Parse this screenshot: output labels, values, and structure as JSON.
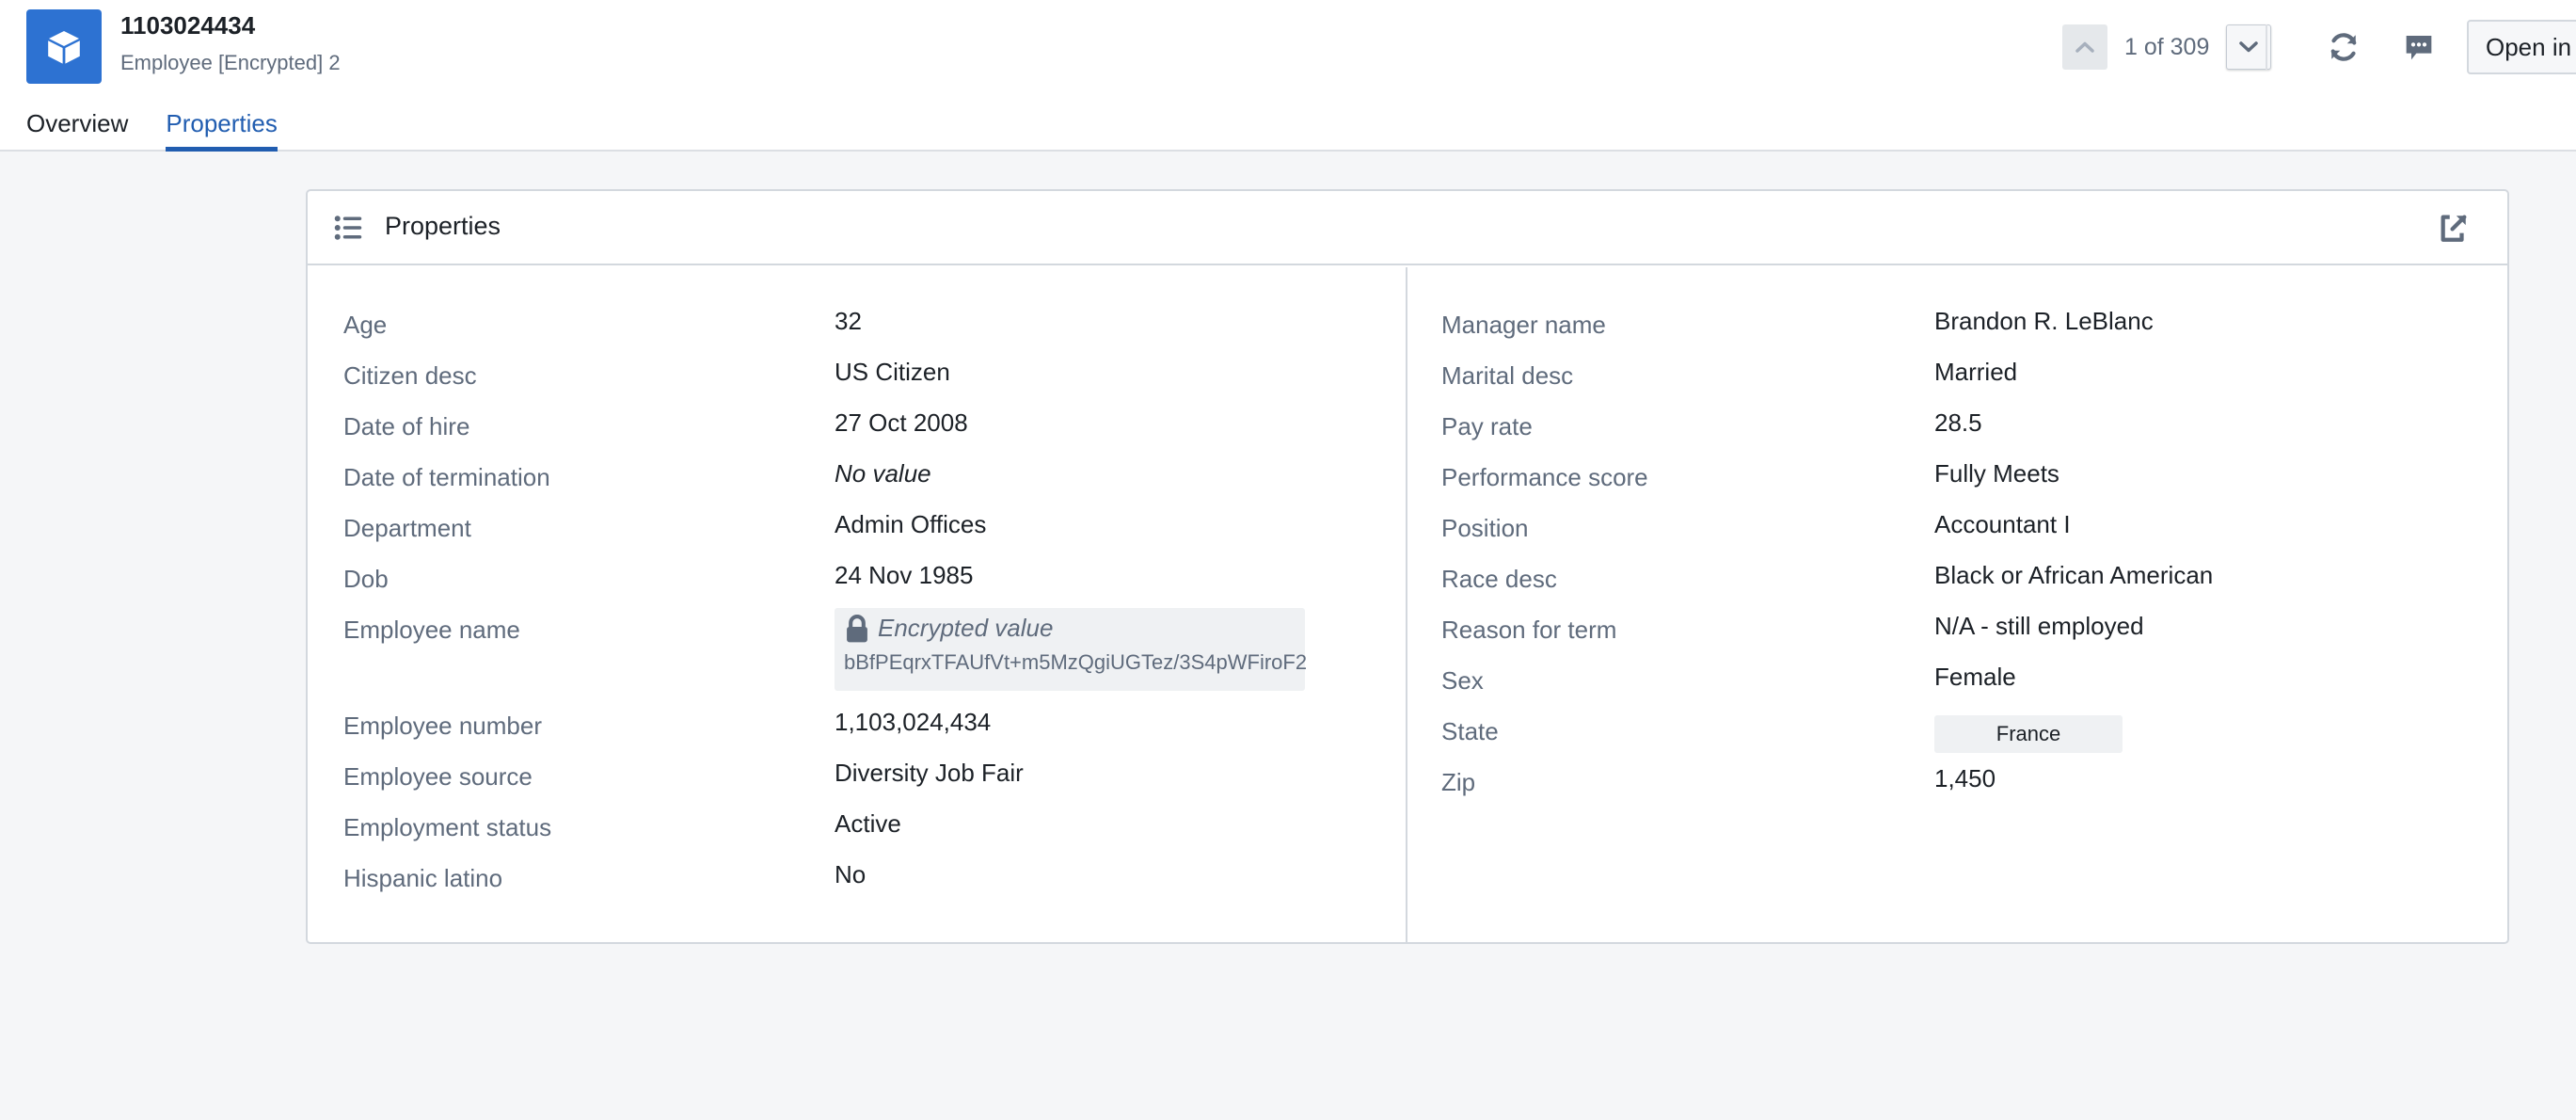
{
  "header": {
    "title": "1103024434",
    "subtitle": "Employee [Encrypted] 2",
    "logo_icon": "cube-icon",
    "accent_color": "#2d72d2",
    "tabs": [
      {
        "label": "Overview",
        "active": false
      },
      {
        "label": "Properties",
        "active": true
      }
    ],
    "navigation": {
      "counter": "1 of 309",
      "prev_icon": "chevron-up-icon",
      "next_icon": "chevron-down-icon"
    },
    "actions": {
      "refresh_icon": "refresh-icon",
      "comments_icon": "comment-icon",
      "open_in_label": "Open in"
    }
  },
  "card": {
    "title": "Properties",
    "title_icon": "properties-list-icon",
    "popout_icon": "share-external-icon",
    "left": [
      {
        "label": "Age",
        "value": "32"
      },
      {
        "label": "Citizen desc",
        "value": "US Citizen"
      },
      {
        "label": "Date of hire",
        "value": "27 Oct 2008"
      },
      {
        "label": "Date of termination",
        "value": "No value"
      },
      {
        "label": "Department",
        "value": "Admin Offices"
      },
      {
        "label": "Dob",
        "value": "24 Nov 1985"
      },
      {
        "label": "Employee name",
        "value": "Encrypted value",
        "encrypted_hash": "bBfPEqrxTFAUfVt+m5MzQgiUGTez/3S4pWFiroF2"
      },
      {
        "label": "Employee number",
        "value": "1,103,024,434"
      },
      {
        "label": "Employee source",
        "value": "Diversity Job Fair"
      },
      {
        "label": "Employment status",
        "value": "Active"
      },
      {
        "label": "Hispanic latino",
        "value": "No"
      }
    ],
    "right": [
      {
        "label": "Manager name",
        "value": "Brandon R. LeBlanc"
      },
      {
        "label": "Marital desc",
        "value": "Married"
      },
      {
        "label": "Pay rate",
        "value": "28.5"
      },
      {
        "label": "Performance score",
        "value": "Fully Meets"
      },
      {
        "label": "Position",
        "value": "Accountant I"
      },
      {
        "label": "Race desc",
        "value": "Black or African American"
      },
      {
        "label": "Reason for term",
        "value": "N/A - still employed"
      },
      {
        "label": "Sex",
        "value": "Female"
      },
      {
        "label": "State",
        "value": "France"
      },
      {
        "label": "Zip",
        "value": "1,450"
      }
    ]
  }
}
